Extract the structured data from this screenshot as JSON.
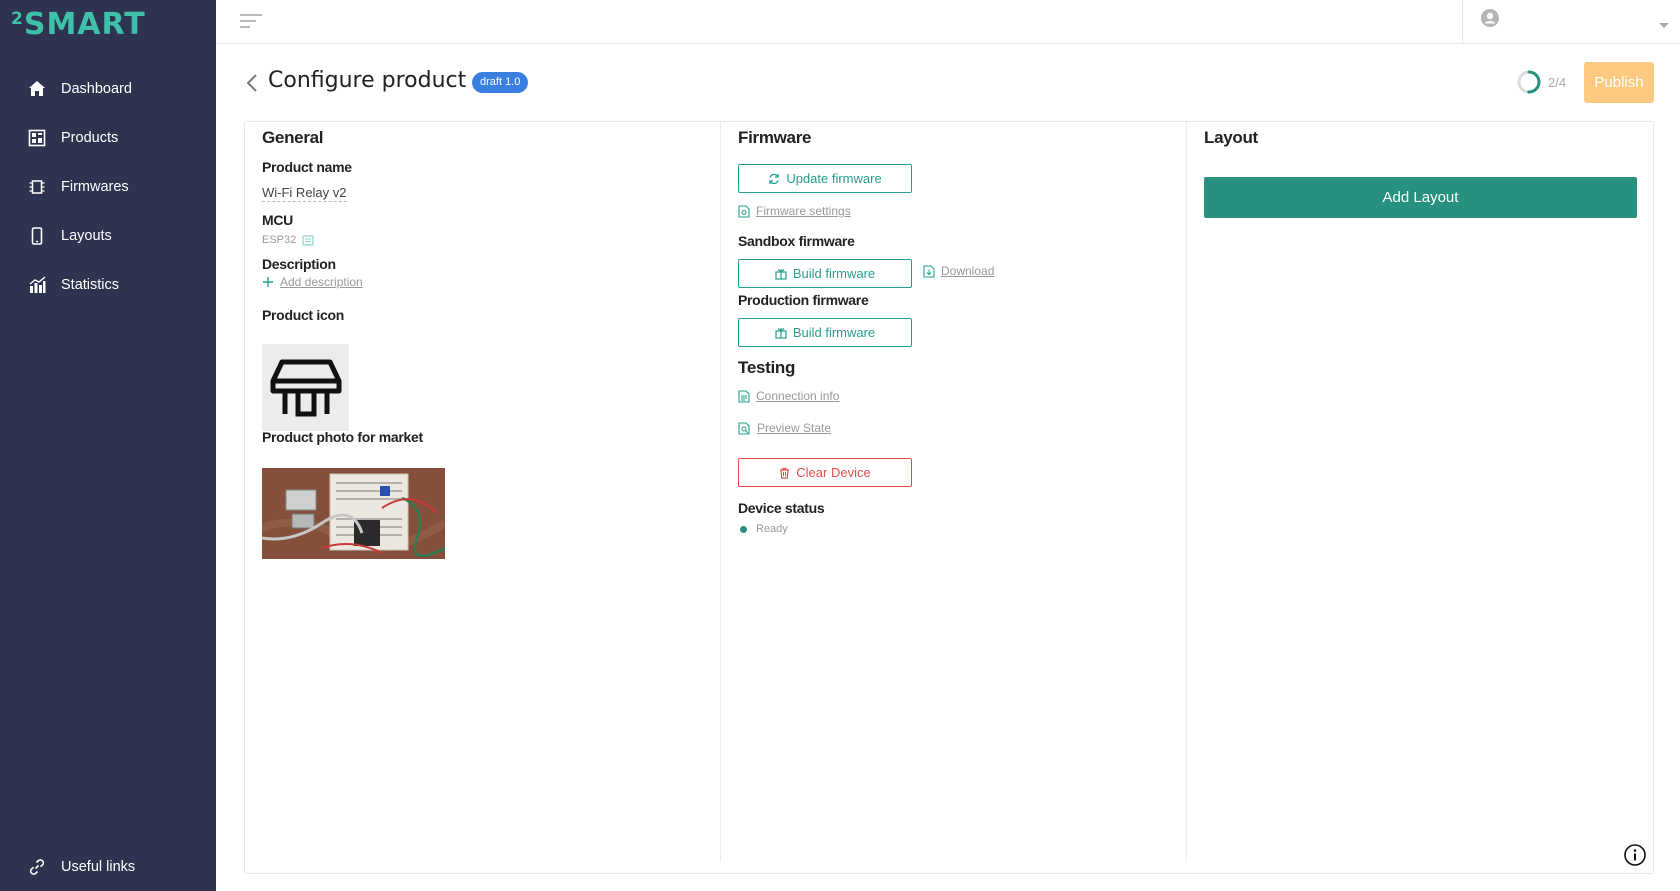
{
  "brand": {
    "logo_sup": "2",
    "logo_word": "SMART",
    "accent": "#3fc1a9"
  },
  "sidebar": {
    "items": [
      {
        "label": "Dashboard",
        "icon": "home-icon"
      },
      {
        "label": "Products",
        "icon": "products-icon"
      },
      {
        "label": "Firmwares",
        "icon": "chip-icon"
      },
      {
        "label": "Layouts",
        "icon": "phone-icon"
      },
      {
        "label": "Statistics",
        "icon": "bar-chart-icon"
      }
    ],
    "bottom": {
      "label": "Useful links",
      "icon": "link-icon"
    }
  },
  "header": {
    "title": "Configure product",
    "badge": "draft 1.0",
    "progress_text": "2/4",
    "progress_fraction": 0.5,
    "publish_label": "Publish"
  },
  "general": {
    "title": "General",
    "product_name_label": "Product name",
    "product_name_value": "Wi-Fi Relay v2",
    "mcu_label": "MCU",
    "mcu_value": "ESP32",
    "description_label": "Description",
    "add_description": "Add description",
    "icon_label": "Product icon",
    "photo_label": "Product photo for market"
  },
  "firmware": {
    "title": "Firmware",
    "update_label": "Update firmware",
    "settings_link": "Firmware settings",
    "sandbox_label": "Sandbox firmware",
    "sandbox_build": "Build firmware",
    "download_link": "Download",
    "production_label": "Production firmware",
    "production_build": "Build firmware",
    "testing_title": "Testing",
    "connection_info": "Connection info",
    "preview_state": "Preview State",
    "clear_device": "Clear Device",
    "status_label": "Device status",
    "status_value": "Ready"
  },
  "layout": {
    "title": "Layout",
    "add_label": "Add Layout"
  },
  "colors": {
    "primary": "#27907f",
    "teal": "#26a08e",
    "danger": "#e74c4c",
    "publish": "#fbc97f",
    "badge": "#3a7fe0",
    "sidebar": "#2e3450"
  }
}
